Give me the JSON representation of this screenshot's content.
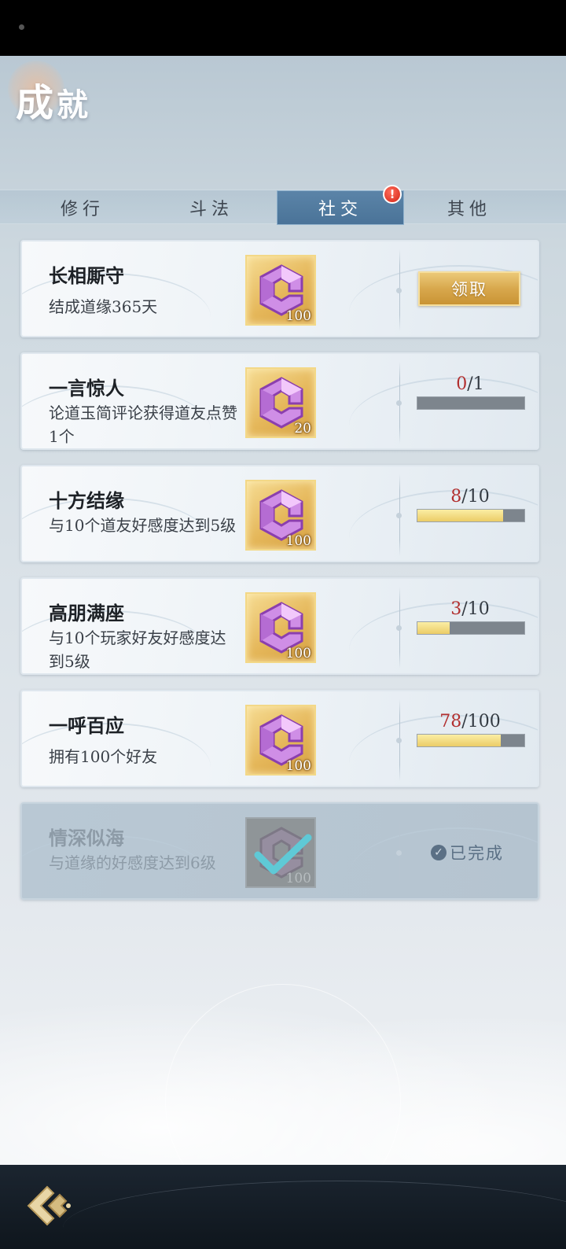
{
  "header": {
    "title_char1": "成",
    "title_char2": "就"
  },
  "tabs": [
    {
      "label": "修行",
      "active": false
    },
    {
      "label": "斗法",
      "active": false
    },
    {
      "label": "社交",
      "active": true,
      "badge": "!"
    },
    {
      "label": "其他",
      "active": false
    }
  ],
  "achievements": [
    {
      "title": "长相厮守",
      "desc": "结成道缘365天",
      "reward_count": "100",
      "action": "领取"
    },
    {
      "title": "一言惊人",
      "desc": "论道玉简评论获得道友点赞1个",
      "reward_count": "20",
      "progress_current": "0",
      "progress_total": "/1",
      "progress": 0.0
    },
    {
      "title": "十方结缘",
      "desc": "与10个道友好感度达到5级",
      "reward_count": "100",
      "progress_current": "8",
      "progress_total": "/10",
      "progress": 0.8
    },
    {
      "title": "高朋满座",
      "desc": "与10个玩家好友好感度达到5级",
      "reward_count": "100",
      "progress_current": "3",
      "progress_total": "/10",
      "progress": 0.3
    },
    {
      "title": "一呼百应",
      "desc": "拥有100个好友",
      "reward_count": "100",
      "progress_current": "78",
      "progress_total": "/100",
      "progress": 0.78
    },
    {
      "title": "情深似海",
      "desc": "与道缘的好感度达到6级",
      "reward_count": "100",
      "status": "已完成"
    }
  ],
  "colors": {
    "tab_active": "#4a7398",
    "gold": "#d8a84d",
    "progress_red": "#b22f2f"
  },
  "icons": {
    "reward": "purple-gem-icon",
    "back": "back-arrow-icon",
    "completed": "check-icon"
  }
}
